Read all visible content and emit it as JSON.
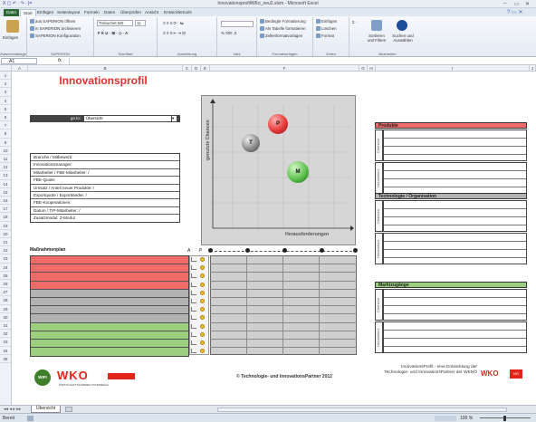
{
  "window": {
    "title": "InnovationsprofilWKo_neu2.xlsm - Microsoft Excel",
    "quick_access": "X  ▢ ↶ · ↷ · |="
  },
  "ribbon_tabs": [
    "Datei",
    "Start",
    "Einfügen",
    "Seitenlayout",
    "Formeln",
    "Daten",
    "Überprüfen",
    "Ansicht",
    "Entwicklertools"
  ],
  "ribbon": {
    "paste": "Einfügen",
    "clipboard": "Zwischenablage",
    "sap1": "aus SAPERION öffnen",
    "sap2": "in SAPERION archivieren",
    "sap3": "SAPERION Konfiguration",
    "sap_group": "SAPERION",
    "font_name": "Trebuchet MS",
    "font_size": "11",
    "font_group": "Schriftart",
    "align_group": "Ausrichtung",
    "number_group": "Zahl",
    "cf": "Bedingte Formatierung",
    "ft": "Als Tabelle formatieren",
    "cs": "Zellenformatvorlagen",
    "styles_group": "Formatvorlagen",
    "ins": "Einfügen",
    "del": "Löschen",
    "fmt": "Format",
    "cells_group": "Zellen",
    "sort": "Sortieren und Filtern",
    "find": "Suchen und Auswählen",
    "edit_group": "Bearbeiten"
  },
  "formula": {
    "cell": "A1",
    "fx": "fx",
    "value": ""
  },
  "columns": [
    "A",
    "B",
    "C",
    "D",
    "E",
    "F",
    "G",
    "H",
    "I",
    "J"
  ],
  "rows": [
    "1",
    "2",
    "3",
    "4",
    "5",
    "6",
    "7",
    "8",
    "9",
    "10",
    "11",
    "12",
    "13",
    "14",
    "15",
    "16",
    "17",
    "18",
    "19",
    "20",
    "21",
    "22",
    "23",
    "24",
    "25",
    "26",
    "27",
    "28",
    "29",
    "30",
    "31",
    "32",
    "33",
    "34",
    "35"
  ],
  "sheet": {
    "title": "Innovationsprofil",
    "goto_label": "go to:",
    "goto_value": "Übersicht",
    "info": [
      "Branche / Mitbewerb:",
      "Innovationsmanager:",
      "Mitarbeiter / FBE-Mitarbeiter:  /",
      "FBE-Quote:",
      "Umsatz / Anteil neuer Produkte:  /",
      "Exportquote / ExportIänder:  /",
      "FBE-Kooperationen:",
      "Datum / TIP-Mitarbeiter:  /",
      "Zusatzmodul: Z-Modul"
    ],
    "measures_label": "Maßnahmenplan",
    "ap_labels": [
      "A",
      "P"
    ],
    "chart": {
      "y_label": "genutzte Chancen",
      "x_label": "Herausforderungen",
      "balls": [
        {
          "label": "P",
          "color": "#e83a3a"
        },
        {
          "label": "T",
          "color": "#8d8d8d"
        },
        {
          "label": "M",
          "color": "#5fc24f"
        }
      ]
    },
    "panels": [
      {
        "title": "Produkte",
        "color": "#f36a6a",
        "labels": [
          "Chancen",
          "Herausford."
        ]
      },
      {
        "title": "Technologie / Organisation",
        "color": "#b3b3b3",
        "labels": [
          "Chancen",
          "Herausford."
        ]
      },
      {
        "title": "Marktzugänge",
        "color": "#9ccf7e",
        "labels": [
          "Chancen",
          "Herausford."
        ]
      }
    ],
    "footer_center": "© Technologie- und InnovationsPartner 2012",
    "footer_right": "InnovationsProfil - eine Entwicklung der Technologie- und InnovationsPartner der WKNÖ",
    "wifi": "WIFI",
    "wko": "WKO",
    "wko_sub": "WIRTSCHAFTSKAMMER ÖSTERREICH",
    "wko_small": "NÖ"
  },
  "sheet_tab": "Übersicht",
  "status": {
    "left": "Bereit",
    "zoom": "100 %"
  }
}
